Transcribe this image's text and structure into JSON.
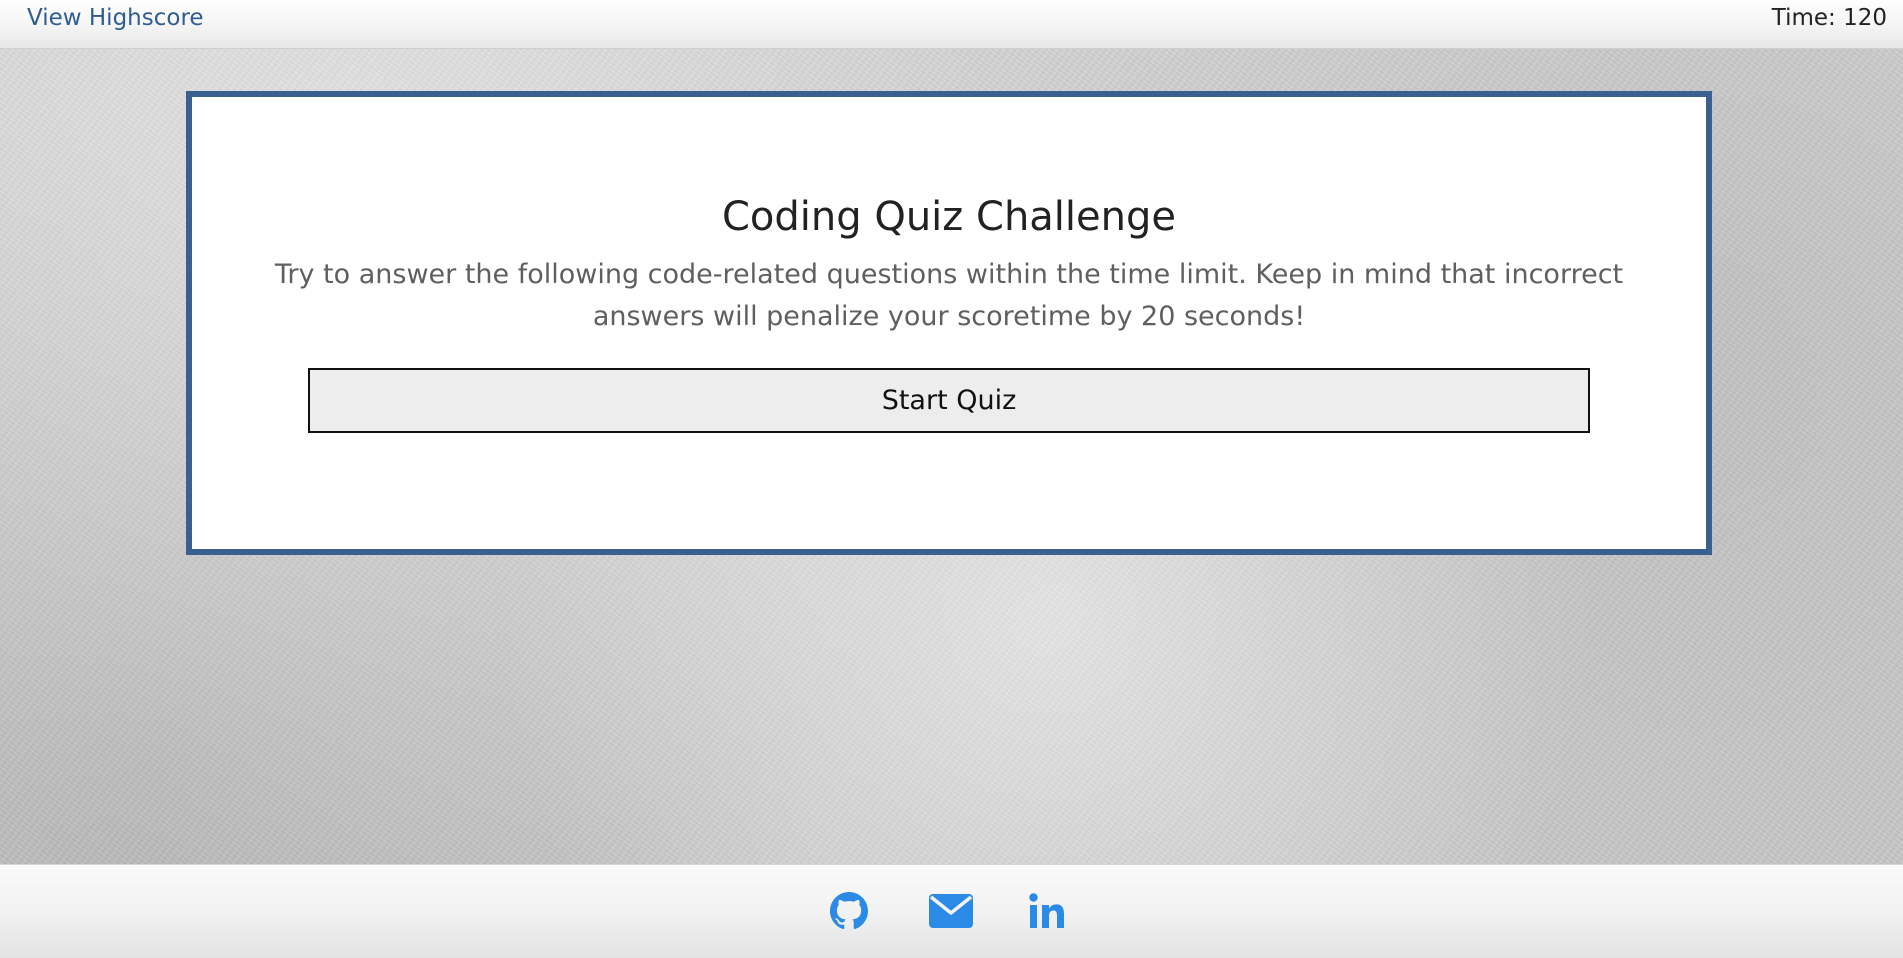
{
  "header": {
    "highscore_label": "View Highscore",
    "timer_label": "Time:",
    "timer_value": "120"
  },
  "main": {
    "title": "Coding Quiz Challenge",
    "description": "Try to answer the following code-related questions within the time limit. Keep in mind that incorrect answers will penalize your scoretime by 20 seconds!",
    "start_button_label": "Start Quiz"
  },
  "footer": {
    "links": [
      {
        "icon": "github-icon"
      },
      {
        "icon": "envelope-icon"
      },
      {
        "icon": "linkedin-icon"
      }
    ]
  },
  "colors": {
    "accent_blue": "#3a5f91",
    "link_blue": "#2f5d93",
    "icon_blue": "#2b8ae6"
  }
}
